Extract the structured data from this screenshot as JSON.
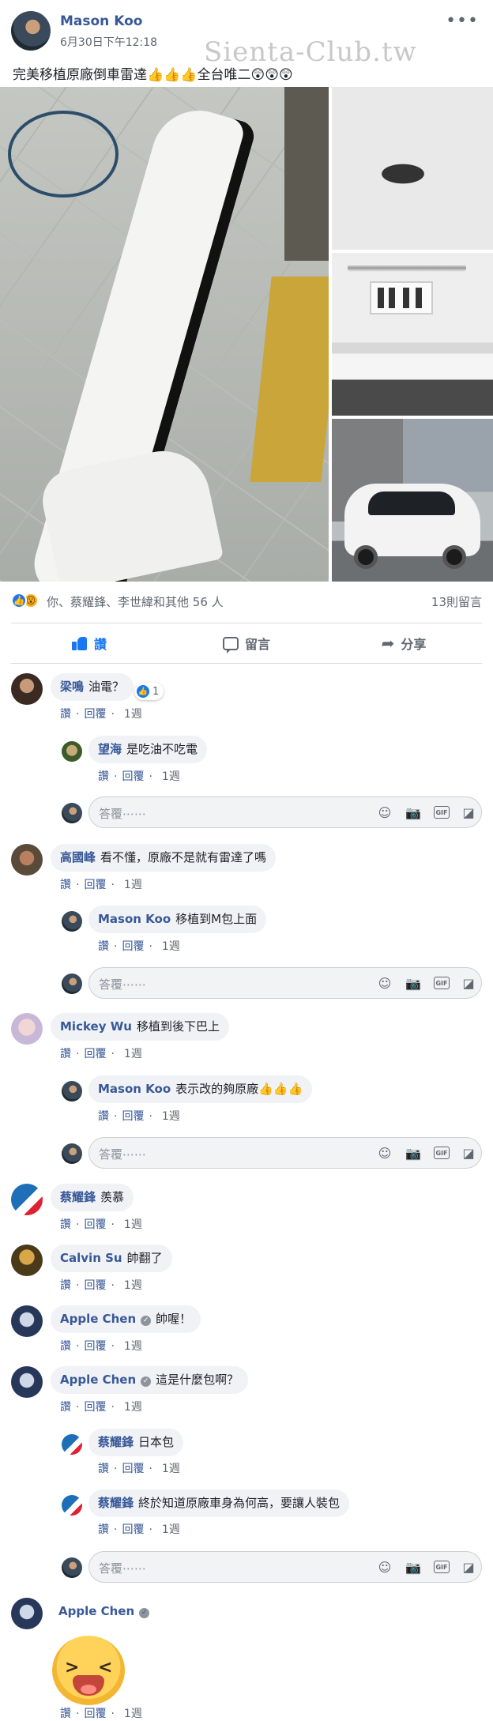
{
  "post": {
    "author": "Mason Koo",
    "time": "6月30日下午12:18",
    "watermark": "Sienta-Club.tw",
    "text": "完美移植原廠倒車雷達👍👍👍全台唯二😲😲😲",
    "more": "•••"
  },
  "reactions": {
    "like_icon": "like-icon",
    "wow_icon": "wow-icon",
    "summary": "你、蔡耀鋒、李世緯和其他 56 人",
    "comment_count": "13則留言"
  },
  "actions": {
    "like": "讚",
    "comment": "留言",
    "share": "分享"
  },
  "meta": {
    "like": "讚",
    "reply": "回覆",
    "age": "1週"
  },
  "reply_placeholder": "答覆⋯⋯",
  "gif": "GIF",
  "comments": [
    {
      "name": "梁鳴",
      "text": "油電？",
      "reactions": "1"
    },
    {
      "name": "望海",
      "text": "是吃油不吃電"
    },
    {
      "name": "高國峰",
      "text": "看不懂，原廠不是就有雷達了嗎"
    },
    {
      "name": "Mason Koo",
      "text": "移植到M包上面"
    },
    {
      "name": "Mickey Wu",
      "text": "移植到後下巴上"
    },
    {
      "name": "Mason Koo",
      "text": "表示改的夠原廠👍👍👍"
    },
    {
      "name": "蔡耀鋒",
      "text": "羨慕"
    },
    {
      "name": "Calvin Su",
      "text": "帥翻了"
    },
    {
      "name": "Apple Chen",
      "text": "帥喔！"
    },
    {
      "name": "Apple Chen",
      "text": "這是什麼包啊？"
    },
    {
      "name": "蔡耀鋒",
      "text": "日本包"
    },
    {
      "name": "蔡耀鋒",
      "text": "終於知道原廠車身為何高，要讓人裝包"
    },
    {
      "name": "Apple Chen",
      "text": ""
    }
  ]
}
